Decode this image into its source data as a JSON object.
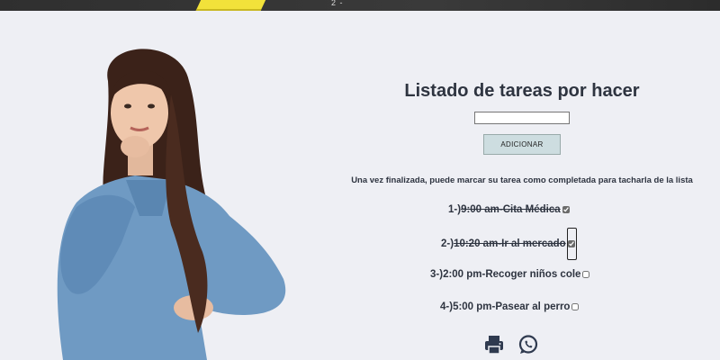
{
  "header": {
    "banner_chalk": "2 -"
  },
  "app": {
    "title": "Listado de tareas por hacer",
    "input_value": "",
    "add_button": "ADICIONAR",
    "instructions": "Una vez finalizada, puede marcar su tarea como completada para tacharla de la lista"
  },
  "tasks": [
    {
      "prefix": "1-)",
      "text": "9:00 am-Cita Médica",
      "completed": true
    },
    {
      "prefix": "2-)",
      "text": "10:20 am-Ir al mercado",
      "completed": true
    },
    {
      "prefix": "3-)",
      "text": "2:00 pm-Recoger niños cole",
      "completed": false
    },
    {
      "prefix": "4-)",
      "text": "5:00 pm-Pasear al perro",
      "completed": false
    }
  ],
  "actions": {
    "print_icon": "printer-icon",
    "share_icon": "whatsapp-icon"
  },
  "colors": {
    "background": "#eeeff4",
    "button": "#cddde0",
    "text": "#2e3440"
  }
}
